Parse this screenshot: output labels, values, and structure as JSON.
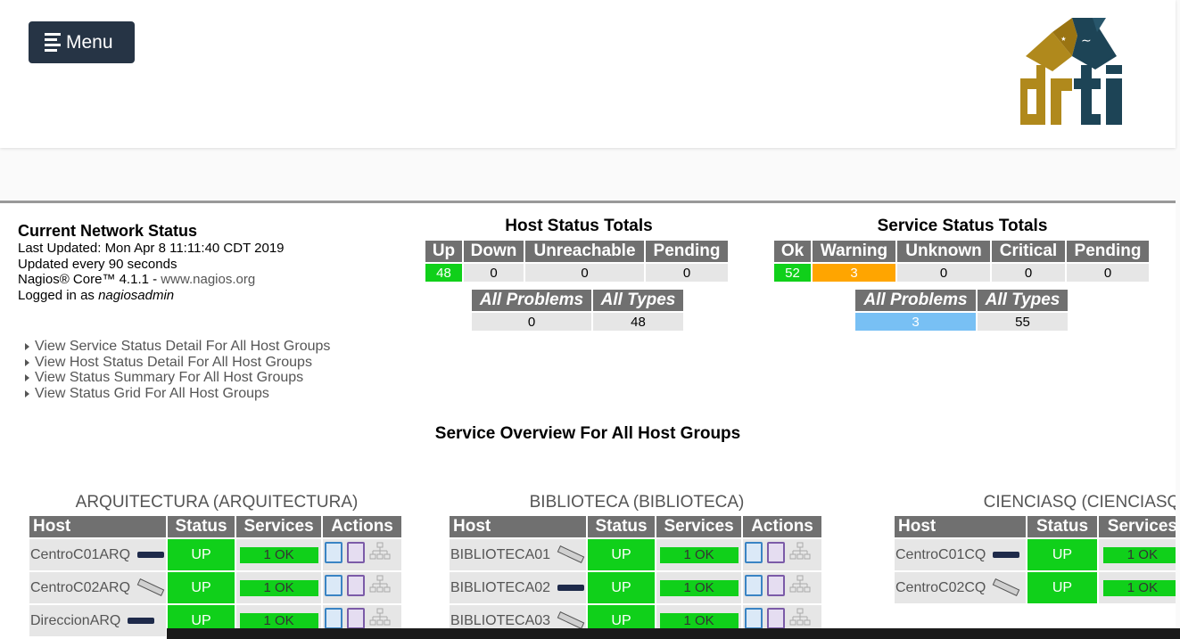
{
  "menu": {
    "label": "Menu"
  },
  "logo": {
    "text": "drti"
  },
  "network_status": {
    "title": "Current Network Status",
    "last_updated": "Last Updated: Mon Apr 8 11:11:40 CDT 2019",
    "update_interval": "Updated every 90 seconds",
    "version_prefix": "Nagios® Core™ 4.1.1 - ",
    "version_link": "www.nagios.org",
    "logged_prefix": "Logged in as ",
    "user": "nagiosadmin"
  },
  "links": [
    "View Service Status Detail For All Host Groups",
    "View Host Status Detail For All Host Groups",
    "View Status Summary For All Host Groups",
    "View Status Grid For All Host Groups"
  ],
  "host_totals": {
    "title": "Host Status Totals",
    "headers": [
      "Up",
      "Down",
      "Unreachable",
      "Pending"
    ],
    "values": [
      "48",
      "0",
      "0",
      "0"
    ],
    "sum_headers": [
      "All Problems",
      "All Types"
    ],
    "sum_values": [
      "0",
      "48"
    ]
  },
  "service_totals": {
    "title": "Service Status Totals",
    "headers": [
      "Ok",
      "Warning",
      "Unknown",
      "Critical",
      "Pending"
    ],
    "values": [
      "52",
      "3",
      "0",
      "0",
      "0"
    ],
    "sum_headers": [
      "All Problems",
      "All Types"
    ],
    "sum_values": [
      "3",
      "55"
    ]
  },
  "overview_title": "Service Overview For All Host Groups",
  "table_headers": {
    "host": "Host",
    "status": "Status",
    "services": "Services",
    "actions": "Actions"
  },
  "colors": {
    "up": "#10d01a",
    "warning": "#ffa500",
    "problems": "#78c0f4",
    "header": "#707070",
    "menu_bg": "#263445"
  },
  "hostgroups": [
    {
      "name": "ARQUITECTURA",
      "alias": "(ARQUITECTURA)",
      "hosts": [
        {
          "host": "CentroC01ARQ",
          "status": "UP",
          "services": "1 OK"
        },
        {
          "host": "CentroC02ARQ",
          "status": "UP",
          "services": "1 OK"
        },
        {
          "host": "DireccionARQ",
          "status": "UP",
          "services": "1 OK"
        }
      ]
    },
    {
      "name": "BIBLIOTECA",
      "alias": "(BIBLIOTECA)",
      "hosts": [
        {
          "host": "BIBLIOTECA01",
          "status": "UP",
          "services": "1 OK"
        },
        {
          "host": "BIBLIOTECA02",
          "status": "UP",
          "services": "1 OK"
        },
        {
          "host": "BIBLIOTECA03",
          "status": "UP",
          "services": "1 OK"
        }
      ]
    },
    {
      "name": "CIENCIASQ",
      "alias": "(CIENCIASQ",
      "hosts": [
        {
          "host": "CentroC01CQ",
          "status": "UP",
          "services": "1 OK"
        },
        {
          "host": "CentroC02CQ",
          "status": "UP",
          "services": "1 OK"
        }
      ]
    }
  ]
}
